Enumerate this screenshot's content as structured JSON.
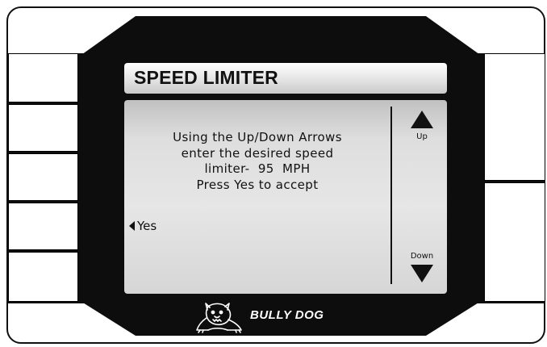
{
  "screen": {
    "title": "SPEED LIMITER",
    "message_lines": [
      "Using the Up/Down Arrows",
      "enter the desired speed",
      "limiter-  95  MPH",
      "Press Yes to accept"
    ],
    "yes_label": "Yes",
    "up_label": "Up",
    "down_label": "Down"
  },
  "brand": {
    "name": "BULLY DOG",
    "logo_icon": "bulldog-icon"
  },
  "colors": {
    "body": "#0d0d0d",
    "lcd": "#e0e0e0",
    "text": "#111111"
  }
}
